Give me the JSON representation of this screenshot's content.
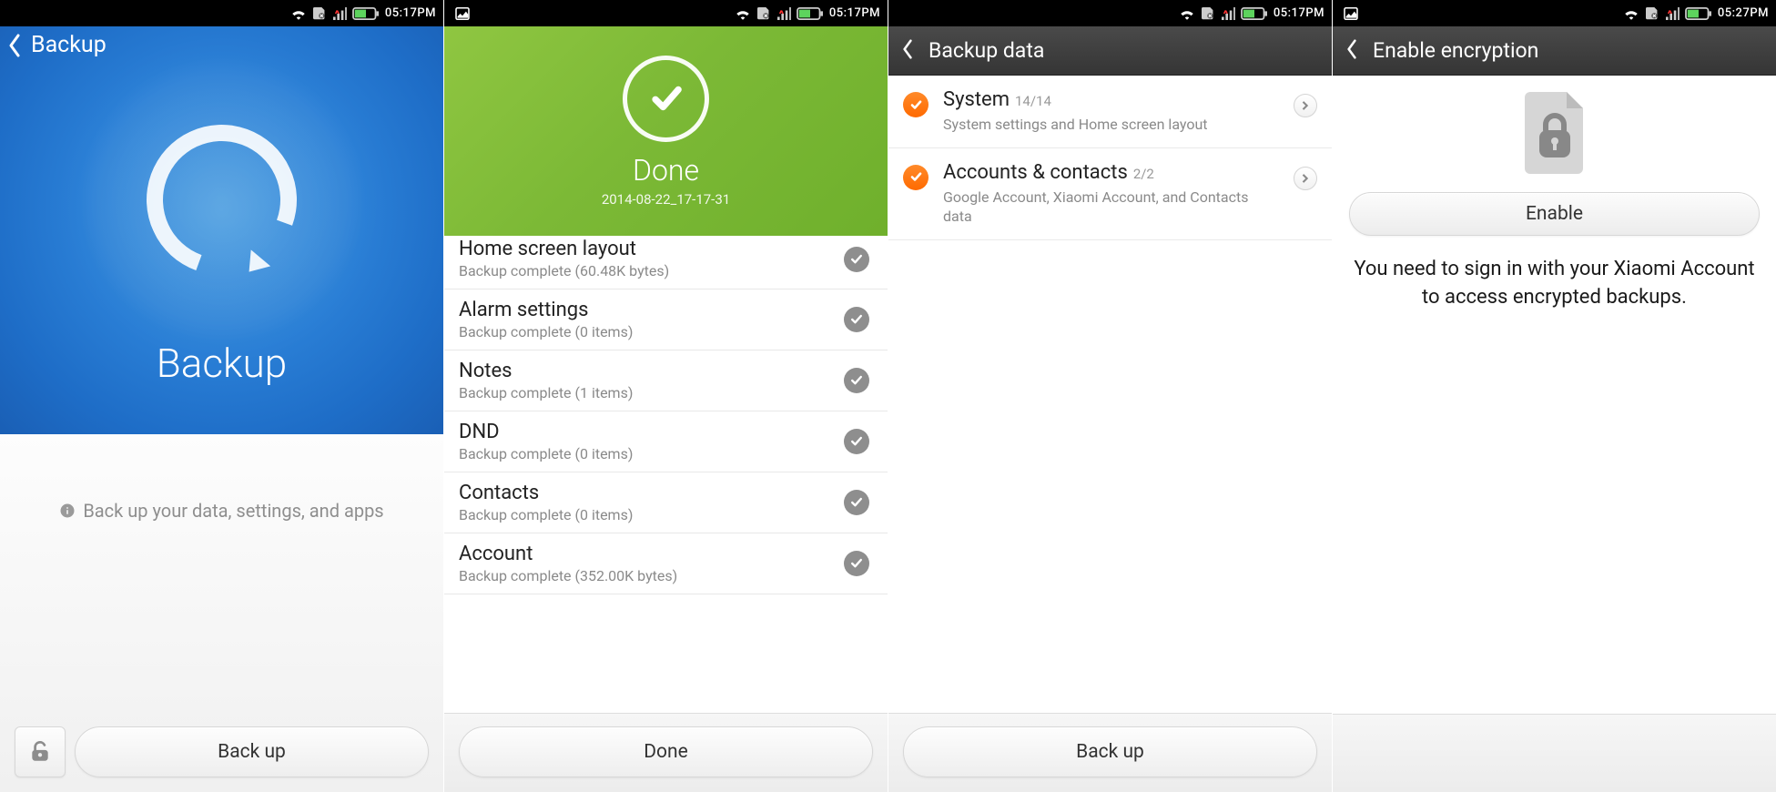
{
  "status": {
    "time_a": "05:17PM",
    "time_b": "05:27PM"
  },
  "screen1": {
    "nav_title": "Backup",
    "hero_label": "Backup",
    "hint": "Back up your data, settings, and apps",
    "action": "Back up"
  },
  "screen2": {
    "done_label": "Done",
    "timestamp": "2014-08-22_17-17-31",
    "items": [
      {
        "name": "Home screen layout",
        "sub": "Backup complete (60.48K  bytes)"
      },
      {
        "name": "Alarm settings",
        "sub": "Backup complete (0  items)"
      },
      {
        "name": "Notes",
        "sub": "Backup complete (1  items)"
      },
      {
        "name": "DND",
        "sub": "Backup complete (0  items)"
      },
      {
        "name": "Contacts",
        "sub": "Backup complete (0  items)"
      },
      {
        "name": "Account",
        "sub": "Backup complete (352.00K  bytes)"
      }
    ],
    "action": "Done"
  },
  "screen3": {
    "nav_title": "Backup data",
    "items": [
      {
        "name": "System",
        "count": "14/14",
        "sub": "System settings and Home screen layout"
      },
      {
        "name": "Accounts & contacts",
        "count": "2/2",
        "sub": "Google Account, Xiaomi Account, and Contacts data"
      }
    ],
    "action": "Back up"
  },
  "screen4": {
    "nav_title": "Enable encryption",
    "action": "Enable",
    "message": "You need to sign in with your Xiaomi Account to access encrypted backups."
  }
}
